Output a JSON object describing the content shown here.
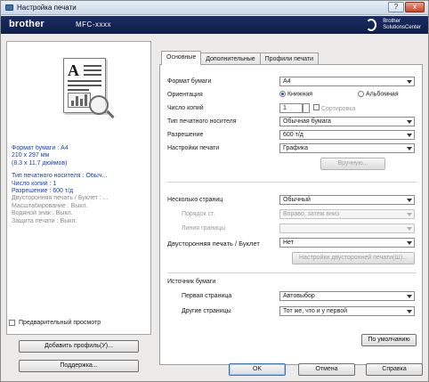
{
  "window": {
    "title": "Настройка печати",
    "brand": "brother",
    "model": "MFC-xxxx",
    "solutions_line1": "Brother",
    "solutions_line2": "SolutionsCenter",
    "controls": [
      "?",
      "x"
    ]
  },
  "preview": {
    "summary_blue": [
      "Формат бумаги : A4",
      "210 x 297 мм",
      "(8.3 x 11.7 дюймов)",
      "",
      "Тип печатного носителя : Обыч...",
      "Число копий : 1",
      "Разрешение : 600 т/д"
    ],
    "summary_grey": [
      "Двусторонняя печать / Буклет : ...",
      "",
      "Масштабирование : Выкл.",
      "Водяной знак : Выкл.",
      "Защита печати : Выкл."
    ],
    "preview_checkbox_label": "Предварительный просмотр",
    "add_profile_label": "Добавить профиль(У)...",
    "support_label": "Поддержка..."
  },
  "tabs": [
    "Основные",
    "Дополнительные",
    "Профили печати"
  ],
  "basic": {
    "paper_size_label": "Формат бумаги",
    "paper_size_value": "A4",
    "orientation_label": "Ориентация",
    "orientation_portrait": "Книжная",
    "orientation_landscape": "Альбомная",
    "copies_label": "Число копий",
    "copies_value": "1",
    "collate_label": "Сортировка",
    "media_type_label": "Тип печатного носителя",
    "media_type_value": "Обычная бумага",
    "resolution_label": "Разрешение",
    "resolution_value": "600 т/д",
    "print_settings_label": "Настройки печати",
    "print_settings_value": "Графика",
    "manual_label": "Вручную...",
    "multiple_pages_label": "Несколько страниц",
    "multiple_pages_value": "Обычный",
    "page_order_label": "Порядок ст.",
    "page_order_value": "Вправо, затем вниз",
    "border_line_label": "Линия границы",
    "border_line_value": "",
    "duplex_label": "Двусторонняя печать / Буклет",
    "duplex_value": "Нет",
    "duplex_settings_label": "Настройки двусторонней печати(Ш)...",
    "paper_source_label": "Источник бумаги",
    "first_page_label": "Первая страница",
    "first_page_value": "Автовыбор",
    "other_pages_label": "Другие страницы",
    "other_pages_value": "Тот же, что и у первой",
    "default_label": "По умолчанию"
  },
  "footer": {
    "ok": "OK",
    "cancel": "Отмена",
    "help": "Справка"
  }
}
